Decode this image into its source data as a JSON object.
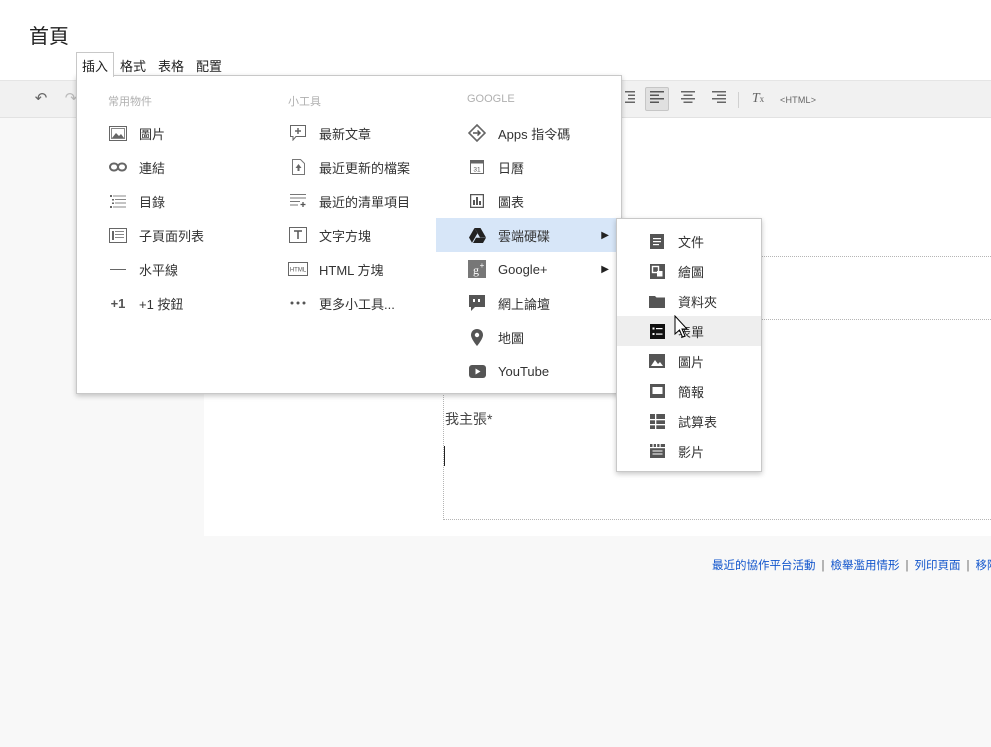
{
  "page": {
    "title": "首頁"
  },
  "menubar": {
    "items": [
      "插入",
      "格式",
      "表格",
      "配置"
    ],
    "active": "插入"
  },
  "toolbar": {
    "undo_icon": "undo-icon",
    "redo_icon": "redo-icon",
    "html_label": "<HTML>"
  },
  "insert_menu": {
    "columns": [
      {
        "header": "常用物件",
        "items": [
          {
            "label": "圖片",
            "icon": "image-icon"
          },
          {
            "label": "連結",
            "icon": "link-icon"
          },
          {
            "label": "目錄",
            "icon": "toc-icon"
          },
          {
            "label": "子頁面列表",
            "icon": "subpage-list-icon"
          },
          {
            "label": "水平線",
            "icon": "horizontal-line-icon"
          },
          {
            "label": "+1 按鈕",
            "icon": "plus-one-icon"
          }
        ]
      },
      {
        "header": "小工具",
        "items": [
          {
            "label": "最新文章",
            "icon": "recent-posts-icon"
          },
          {
            "label": "最近更新的檔案",
            "icon": "recent-files-icon"
          },
          {
            "label": "最近的清單項目",
            "icon": "recent-list-items-icon"
          },
          {
            "label": "文字方塊",
            "icon": "text-box-icon"
          },
          {
            "label": "HTML 方塊",
            "icon": "html-box-icon"
          },
          {
            "label": "更多小工具...",
            "icon": "more-gadgets-icon"
          }
        ]
      },
      {
        "header": "GOOGLE",
        "items": [
          {
            "label": "Apps 指令碼",
            "icon": "apps-script-icon"
          },
          {
            "label": "日曆",
            "icon": "calendar-icon"
          },
          {
            "label": "圖表",
            "icon": "chart-icon"
          },
          {
            "label": "雲端硬碟",
            "icon": "drive-icon",
            "submenu": true,
            "highlighted": true
          },
          {
            "label": "Google+",
            "icon": "google-plus-icon",
            "submenu": true
          },
          {
            "label": "網上論壇",
            "icon": "groups-icon"
          },
          {
            "label": "地圖",
            "icon": "map-pin-icon"
          },
          {
            "label": "YouTube",
            "icon": "youtube-icon"
          }
        ]
      }
    ]
  },
  "drive_submenu": {
    "items": [
      {
        "label": "文件",
        "icon": "document-icon"
      },
      {
        "label": "繪圖",
        "icon": "drawing-icon"
      },
      {
        "label": "資料夾",
        "icon": "folder-icon"
      },
      {
        "label": "表單",
        "icon": "form-icon",
        "hovered": true
      },
      {
        "label": "圖片",
        "icon": "image-icon"
      },
      {
        "label": "簡報",
        "icon": "presentation-icon"
      },
      {
        "label": "試算表",
        "icon": "spreadsheet-icon"
      },
      {
        "label": "影片",
        "icon": "video-icon"
      }
    ]
  },
  "content": {
    "text": "我主張*"
  },
  "footer": {
    "links": [
      "最近的協作平台活動",
      "檢舉濫用情形",
      "列印頁面",
      "移除"
    ]
  }
}
